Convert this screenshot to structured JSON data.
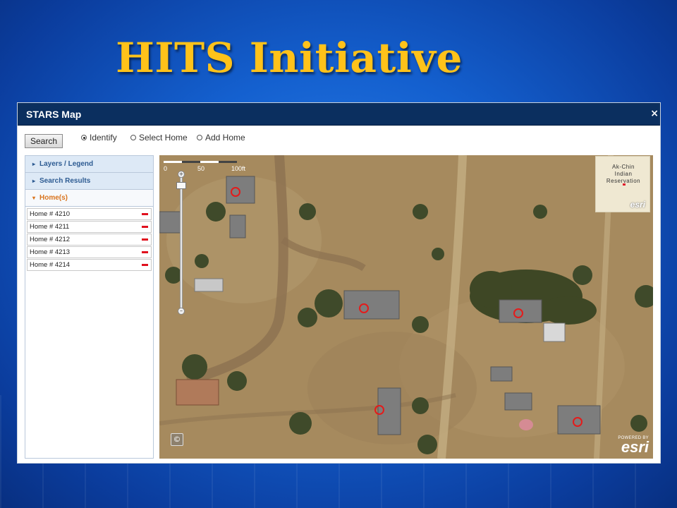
{
  "slide": {
    "title": "HITS Initiative"
  },
  "window": {
    "title": "STARS Map",
    "close_glyph": "×"
  },
  "toolbar": {
    "search_label": "Search",
    "modes": [
      {
        "label": "Identify",
        "selected": true
      },
      {
        "label": "Select Home",
        "selected": false
      },
      {
        "label": "Add Home",
        "selected": false
      }
    ]
  },
  "sidebar": {
    "sections": [
      {
        "label": "Layers / Legend",
        "expanded": false
      },
      {
        "label": "Search Results",
        "expanded": false
      },
      {
        "label": "Home(s)",
        "expanded": true
      }
    ],
    "homes": [
      "Home # 4210",
      "Home # 4211",
      "Home # 4212",
      "Home # 4213",
      "Home # 4214"
    ]
  },
  "map": {
    "scale": {
      "labels": [
        "0",
        "50",
        "100ft"
      ]
    },
    "overview": {
      "label_lines": [
        "Ak-Chin",
        "Indian",
        "Reservation"
      ],
      "logo": "esri"
    },
    "attribution": {
      "copyright_glyph": "©",
      "powered_by": "POWERED BY",
      "logo": "esri"
    },
    "marker_color": "#e41b1b"
  },
  "colors": {
    "title": "#ffc21a",
    "titlebar": "#0b2f5f",
    "accordion_active": "#d9741f",
    "remove": "#e0101e"
  }
}
